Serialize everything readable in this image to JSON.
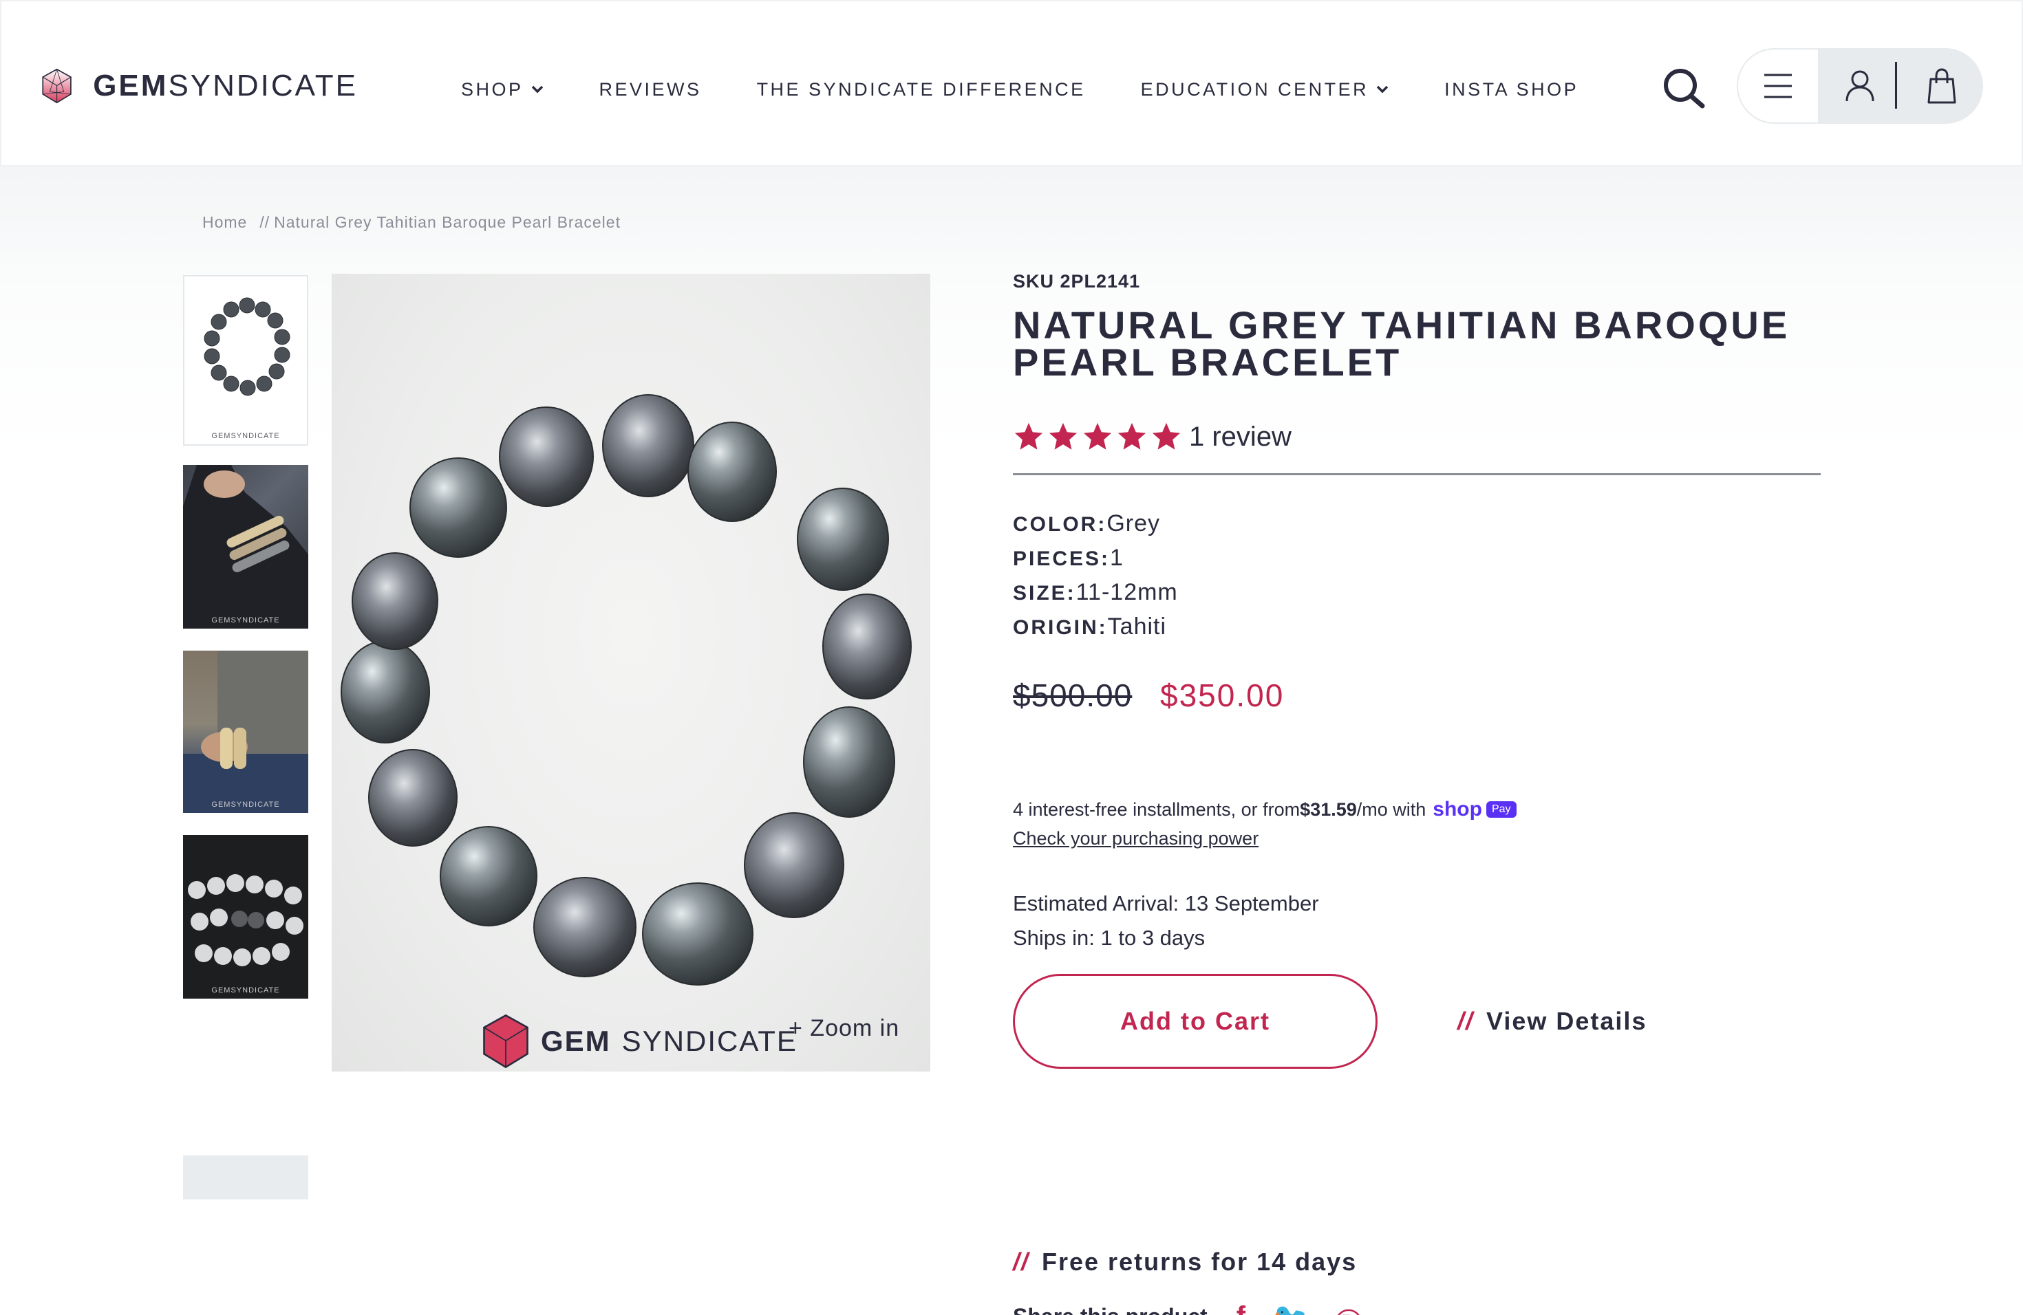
{
  "header": {
    "logo_bold": "GEM",
    "logo_light": "SYNDICATE",
    "nav": [
      {
        "label": "SHOP",
        "has_dropdown": true
      },
      {
        "label": "REVIEWS",
        "has_dropdown": false
      },
      {
        "label": "THE SYNDICATE DIFFERENCE",
        "has_dropdown": false
      },
      {
        "label": "EDUCATION CENTER",
        "has_dropdown": true
      },
      {
        "label": "INSTA SHOP",
        "has_dropdown": false
      }
    ],
    "icons": [
      "search-icon",
      "menu-icon",
      "user-icon",
      "shopping-bag-icon"
    ]
  },
  "breadcrumb": {
    "home": "Home",
    "separator": "//",
    "current": "Natural Grey Tahitian Baroque Pearl Bracelet"
  },
  "gallery": {
    "thumbnail_watermark": "GEMSYNDICATE",
    "watermark_bold": "GEM",
    "watermark_light": "SYNDICATE",
    "zoom_label": "+ Zoom in"
  },
  "product": {
    "sku": "SKU 2PL2141",
    "title": "NATURAL GREY TAHITIAN BAROQUE PEARL BRACELET",
    "rating": 5,
    "review_count": "1 review",
    "specs": [
      {
        "key": "COLOR:",
        "value": "Grey"
      },
      {
        "key": "PIECES:",
        "value": "1"
      },
      {
        "key": "SIZE:",
        "value": "11-12mm"
      },
      {
        "key": "ORIGIN:",
        "value": "Tahiti"
      }
    ],
    "price_original": "$500.00",
    "price_sale": "$350.00",
    "installments_pre": "4 interest-free installments, or from ",
    "installments_amount": "$31.59",
    "installments_post": "/mo with ",
    "shop_logo": "shop",
    "pay_badge": "Pay",
    "check_power": "Check your purchasing power",
    "arrival": "Estimated Arrival: 13 September",
    "ships": "Ships in: 1 to 3 days",
    "add_to_cart": "Add to Cart",
    "view_details": "View Details",
    "slashes": "//",
    "free_returns": "Free returns for 14 days",
    "share_label": "Share this product"
  },
  "colors": {
    "accent": "#c2254f",
    "text": "#2a2b3d",
    "shop_pay": "#5a31f4"
  }
}
